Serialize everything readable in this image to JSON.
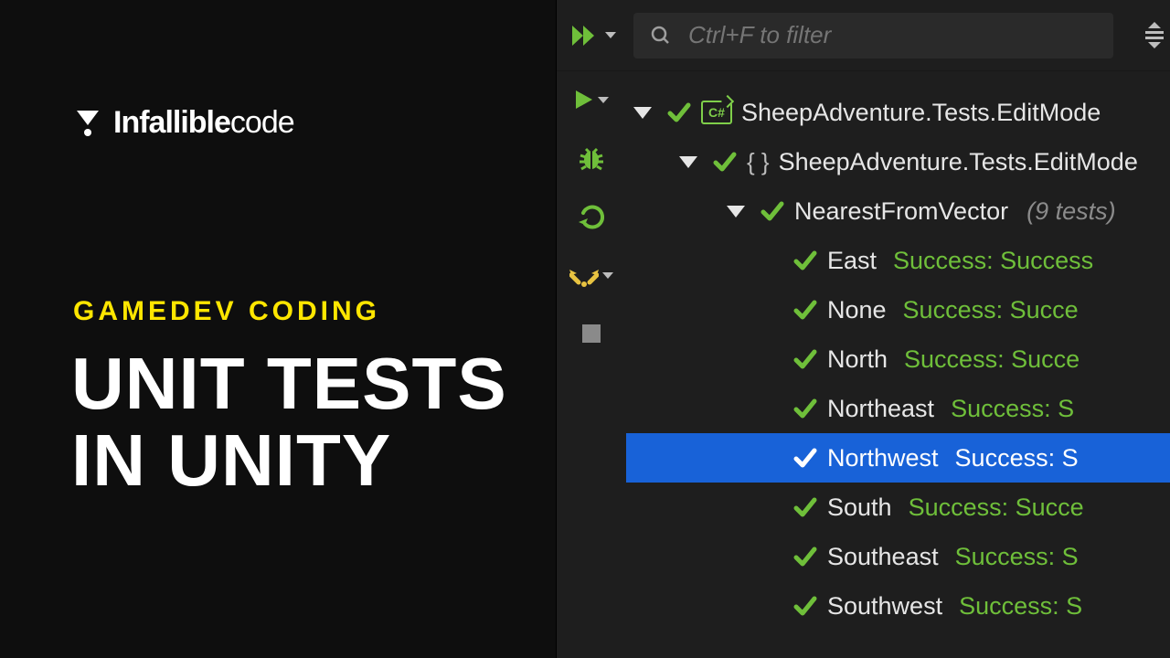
{
  "brand": {
    "bold": "Infallible",
    "light": "code"
  },
  "subtitle": "GAMEDEV CODING",
  "title_line1": "UNIT TESTS",
  "title_line2": "IN UNITY",
  "search": {
    "placeholder": "Ctrl+F to filter"
  },
  "tree": {
    "root_label": "SheepAdventure.Tests.EditMode",
    "ns_label": "SheepAdventure.Tests.EditMode",
    "fixture_label": "NearestFromVector",
    "fixture_count": "(9 tests)",
    "file_badge": "C#",
    "tests": [
      {
        "name": "East",
        "status": "Success:",
        "detail": "Success",
        "selected": false
      },
      {
        "name": "None",
        "status": "Success:",
        "detail": "Succe",
        "selected": false
      },
      {
        "name": "North",
        "status": "Success:",
        "detail": "Succe",
        "selected": false
      },
      {
        "name": "Northeast",
        "status": "Success:",
        "detail": "S",
        "selected": false
      },
      {
        "name": "Northwest",
        "status": "Success:",
        "detail": "S",
        "selected": true
      },
      {
        "name": "South",
        "status": "Success:",
        "detail": "Succe",
        "selected": false
      },
      {
        "name": "Southeast",
        "status": "Success:",
        "detail": "S",
        "selected": false
      },
      {
        "name": "Southwest",
        "status": "Success:",
        "detail": "S",
        "selected": false
      }
    ]
  },
  "colors": {
    "accent_green": "#6fbf3a",
    "accent_yellow": "#ffe600",
    "selection": "#1862d8"
  }
}
